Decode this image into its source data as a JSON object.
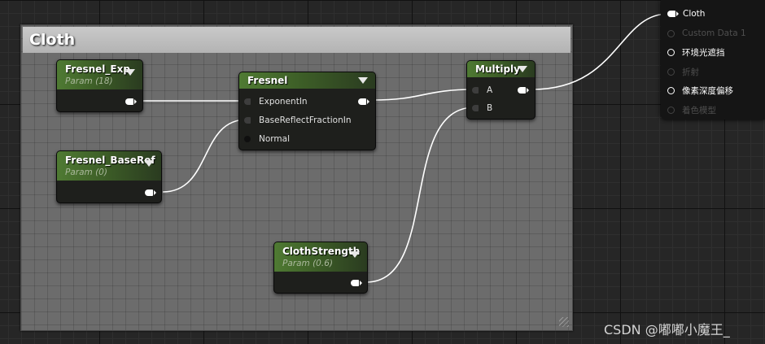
{
  "comment": {
    "title": "Cloth"
  },
  "nodes": {
    "fresnel_exp": {
      "title": "Fresnel_Exp",
      "subtitle": "Param (18)"
    },
    "fresnel_baseref": {
      "title": "Fresnel_BaseRef",
      "subtitle": "Param (0)"
    },
    "fresnel": {
      "title": "Fresnel",
      "inputs": [
        "ExponentIn",
        "BaseReflectFractionIn",
        "Normal"
      ]
    },
    "multiply": {
      "title": "Multiply",
      "inputs": [
        "A",
        "B"
      ]
    },
    "cloth_strength": {
      "title": "ClothStrength",
      "subtitle": "Param (0.6)"
    }
  },
  "result_node": {
    "pins": [
      {
        "label": "Cloth",
        "state": "connected"
      },
      {
        "label": "Custom Data 1",
        "state": "disabled"
      },
      {
        "label": "环境光遮挡",
        "state": "enabled"
      },
      {
        "label": "折射",
        "state": "disabled"
      },
      {
        "label": "像素深度偏移",
        "state": "enabled"
      },
      {
        "label": "着色模型",
        "state": "disabled"
      }
    ]
  },
  "colors": {
    "header_green": "#4f7a33",
    "wire": "#ffffff",
    "comment_bg": "#6c6c6c",
    "graph_bg": "#262626"
  },
  "watermark": "CSDN @嘟嘟小魔王_"
}
